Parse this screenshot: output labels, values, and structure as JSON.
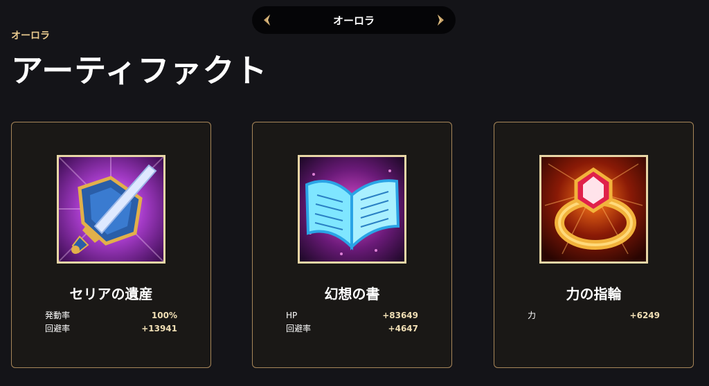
{
  "header": {
    "character_name": "オーロラ",
    "prev_icon": "chevron-left-icon",
    "next_icon": "chevron-right-icon",
    "subtitle": "オーロラ",
    "title": "アーティファクト"
  },
  "colors": {
    "background": "#141418",
    "accent_gold": "#e8c98e",
    "card_border": "#a8875a",
    "stat_value": "#f1dfb5"
  },
  "artifacts": [
    {
      "name": "セリアの遺産",
      "image": "sword-shield-icon",
      "stats": [
        {
          "label": "発動率",
          "value": "100%"
        },
        {
          "label": "回避率",
          "value": "+13941"
        }
      ]
    },
    {
      "name": "幻想の書",
      "image": "magic-book-icon",
      "stats": [
        {
          "label": "HP",
          "value": "+83649"
        },
        {
          "label": "回避率",
          "value": "+4647"
        }
      ]
    },
    {
      "name": "力の指輪",
      "image": "ruby-ring-icon",
      "stats": [
        {
          "label": "力",
          "value": "+6249"
        }
      ]
    }
  ]
}
